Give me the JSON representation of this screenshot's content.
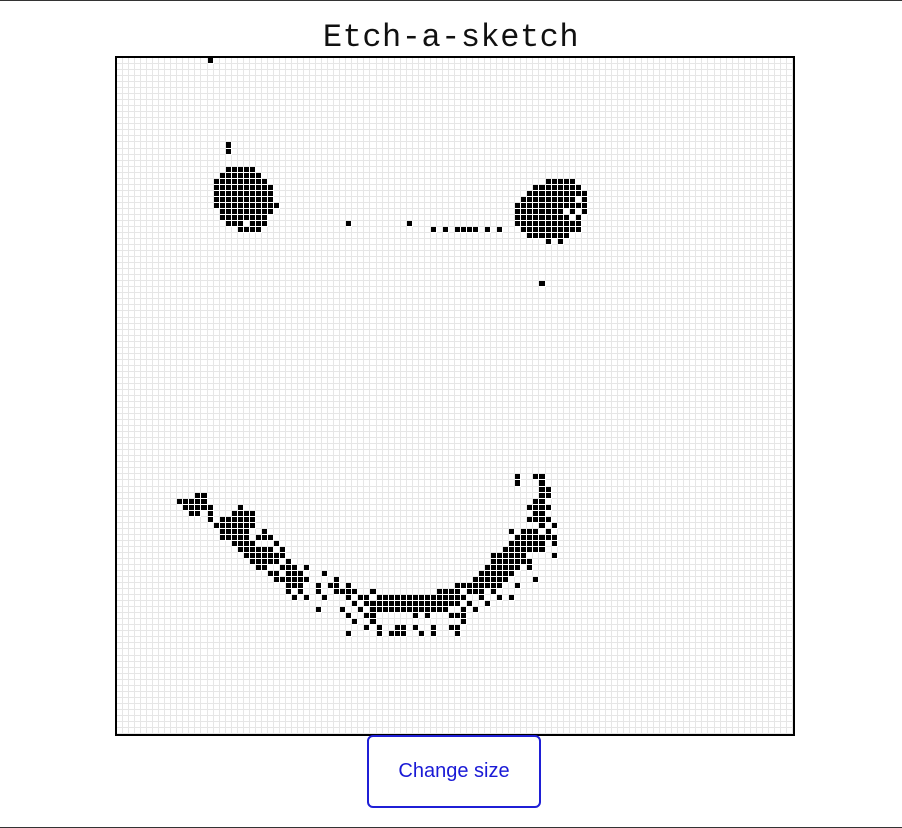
{
  "header": {
    "title": "Etch-a-sketch"
  },
  "board": {
    "cells_per_side": 112,
    "ink_color": "#000000",
    "grid_line_color": "#e6e6e6",
    "painted_cells": [
      [
        15,
        0
      ],
      [
        18,
        14
      ],
      [
        18,
        15
      ],
      [
        18,
        18
      ],
      [
        19,
        18
      ],
      [
        20,
        18
      ],
      [
        21,
        18
      ],
      [
        22,
        18
      ],
      [
        17,
        19
      ],
      [
        18,
        19
      ],
      [
        19,
        19
      ],
      [
        20,
        19
      ],
      [
        21,
        19
      ],
      [
        22,
        19
      ],
      [
        23,
        19
      ],
      [
        16,
        20
      ],
      [
        17,
        20
      ],
      [
        18,
        20
      ],
      [
        19,
        20
      ],
      [
        20,
        20
      ],
      [
        21,
        20
      ],
      [
        22,
        20
      ],
      [
        23,
        20
      ],
      [
        24,
        20
      ],
      [
        16,
        21
      ],
      [
        17,
        21
      ],
      [
        18,
        21
      ],
      [
        19,
        21
      ],
      [
        20,
        21
      ],
      [
        21,
        21
      ],
      [
        22,
        21
      ],
      [
        23,
        21
      ],
      [
        24,
        21
      ],
      [
        25,
        21
      ],
      [
        16,
        22
      ],
      [
        17,
        22
      ],
      [
        18,
        22
      ],
      [
        19,
        22
      ],
      [
        20,
        22
      ],
      [
        21,
        22
      ],
      [
        22,
        22
      ],
      [
        23,
        22
      ],
      [
        24,
        22
      ],
      [
        25,
        22
      ],
      [
        16,
        23
      ],
      [
        17,
        23
      ],
      [
        18,
        23
      ],
      [
        19,
        23
      ],
      [
        20,
        23
      ],
      [
        21,
        23
      ],
      [
        22,
        23
      ],
      [
        23,
        23
      ],
      [
        24,
        23
      ],
      [
        25,
        23
      ],
      [
        16,
        24
      ],
      [
        17,
        24
      ],
      [
        18,
        24
      ],
      [
        19,
        24
      ],
      [
        20,
        24
      ],
      [
        21,
        24
      ],
      [
        22,
        24
      ],
      [
        23,
        24
      ],
      [
        24,
        24
      ],
      [
        25,
        24
      ],
      [
        26,
        24
      ],
      [
        17,
        25
      ],
      [
        18,
        25
      ],
      [
        19,
        25
      ],
      [
        20,
        25
      ],
      [
        21,
        25
      ],
      [
        22,
        25
      ],
      [
        23,
        25
      ],
      [
        24,
        25
      ],
      [
        25,
        25
      ],
      [
        17,
        26
      ],
      [
        18,
        26
      ],
      [
        19,
        26
      ],
      [
        20,
        26
      ],
      [
        21,
        26
      ],
      [
        22,
        26
      ],
      [
        23,
        26
      ],
      [
        24,
        26
      ],
      [
        18,
        27
      ],
      [
        19,
        27
      ],
      [
        20,
        27
      ],
      [
        22,
        27
      ],
      [
        23,
        27
      ],
      [
        24,
        27
      ],
      [
        20,
        28
      ],
      [
        21,
        28
      ],
      [
        22,
        28
      ],
      [
        23,
        28
      ],
      [
        38,
        27
      ],
      [
        48,
        27
      ],
      [
        52,
        28
      ],
      [
        54,
        28
      ],
      [
        56,
        28
      ],
      [
        57,
        28
      ],
      [
        58,
        28
      ],
      [
        59,
        28
      ],
      [
        61,
        28
      ],
      [
        63,
        28
      ],
      [
        71,
        20
      ],
      [
        72,
        20
      ],
      [
        73,
        20
      ],
      [
        74,
        20
      ],
      [
        75,
        20
      ],
      [
        69,
        21
      ],
      [
        70,
        21
      ],
      [
        71,
        21
      ],
      [
        72,
        21
      ],
      [
        73,
        21
      ],
      [
        74,
        21
      ],
      [
        75,
        21
      ],
      [
        76,
        21
      ],
      [
        68,
        22
      ],
      [
        69,
        22
      ],
      [
        70,
        22
      ],
      [
        71,
        22
      ],
      [
        72,
        22
      ],
      [
        73,
        22
      ],
      [
        74,
        22
      ],
      [
        75,
        22
      ],
      [
        76,
        22
      ],
      [
        77,
        22
      ],
      [
        67,
        23
      ],
      [
        68,
        23
      ],
      [
        69,
        23
      ],
      [
        70,
        23
      ],
      [
        71,
        23
      ],
      [
        72,
        23
      ],
      [
        73,
        23
      ],
      [
        74,
        23
      ],
      [
        75,
        23
      ],
      [
        77,
        23
      ],
      [
        66,
        24
      ],
      [
        67,
        24
      ],
      [
        68,
        24
      ],
      [
        69,
        24
      ],
      [
        70,
        24
      ],
      [
        71,
        24
      ],
      [
        72,
        24
      ],
      [
        73,
        24
      ],
      [
        74,
        24
      ],
      [
        75,
        24
      ],
      [
        76,
        24
      ],
      [
        77,
        24
      ],
      [
        66,
        25
      ],
      [
        67,
        25
      ],
      [
        68,
        25
      ],
      [
        69,
        25
      ],
      [
        70,
        25
      ],
      [
        71,
        25
      ],
      [
        72,
        25
      ],
      [
        73,
        25
      ],
      [
        75,
        25
      ],
      [
        77,
        25
      ],
      [
        66,
        26
      ],
      [
        67,
        26
      ],
      [
        68,
        26
      ],
      [
        69,
        26
      ],
      [
        70,
        26
      ],
      [
        71,
        26
      ],
      [
        72,
        26
      ],
      [
        73,
        26
      ],
      [
        74,
        26
      ],
      [
        76,
        26
      ],
      [
        66,
        27
      ],
      [
        67,
        27
      ],
      [
        68,
        27
      ],
      [
        69,
        27
      ],
      [
        70,
        27
      ],
      [
        71,
        27
      ],
      [
        72,
        27
      ],
      [
        73,
        27
      ],
      [
        74,
        27
      ],
      [
        75,
        27
      ],
      [
        76,
        27
      ],
      [
        67,
        28
      ],
      [
        68,
        28
      ],
      [
        69,
        28
      ],
      [
        70,
        28
      ],
      [
        71,
        28
      ],
      [
        72,
        28
      ],
      [
        73,
        28
      ],
      [
        74,
        28
      ],
      [
        75,
        28
      ],
      [
        76,
        28
      ],
      [
        68,
        29
      ],
      [
        69,
        29
      ],
      [
        70,
        29
      ],
      [
        71,
        29
      ],
      [
        72,
        29
      ],
      [
        73,
        29
      ],
      [
        74,
        29
      ],
      [
        71,
        30
      ],
      [
        73,
        30
      ],
      [
        70,
        37
      ],
      [
        66,
        69
      ],
      [
        69,
        69
      ],
      [
        70,
        69
      ],
      [
        66,
        70
      ],
      [
        70,
        70
      ],
      [
        70,
        71
      ],
      [
        71,
        71
      ],
      [
        13,
        72
      ],
      [
        14,
        72
      ],
      [
        70,
        72
      ],
      [
        71,
        72
      ],
      [
        10,
        73
      ],
      [
        11,
        73
      ],
      [
        12,
        73
      ],
      [
        13,
        73
      ],
      [
        14,
        73
      ],
      [
        69,
        73
      ],
      [
        70,
        73
      ],
      [
        11,
        74
      ],
      [
        12,
        74
      ],
      [
        13,
        74
      ],
      [
        14,
        74
      ],
      [
        15,
        74
      ],
      [
        20,
        74
      ],
      [
        68,
        74
      ],
      [
        69,
        74
      ],
      [
        70,
        74
      ],
      [
        71,
        74
      ],
      [
        12,
        75
      ],
      [
        13,
        75
      ],
      [
        15,
        75
      ],
      [
        19,
        75
      ],
      [
        20,
        75
      ],
      [
        21,
        75
      ],
      [
        22,
        75
      ],
      [
        69,
        75
      ],
      [
        70,
        75
      ],
      [
        15,
        76
      ],
      [
        17,
        76
      ],
      [
        18,
        76
      ],
      [
        19,
        76
      ],
      [
        20,
        76
      ],
      [
        21,
        76
      ],
      [
        22,
        76
      ],
      [
        68,
        76
      ],
      [
        69,
        76
      ],
      [
        70,
        76
      ],
      [
        71,
        76
      ],
      [
        16,
        77
      ],
      [
        17,
        77
      ],
      [
        18,
        77
      ],
      [
        19,
        77
      ],
      [
        20,
        77
      ],
      [
        21,
        77
      ],
      [
        22,
        77
      ],
      [
        70,
        77
      ],
      [
        72,
        77
      ],
      [
        17,
        78
      ],
      [
        18,
        78
      ],
      [
        19,
        78
      ],
      [
        20,
        78
      ],
      [
        21,
        78
      ],
      [
        24,
        78
      ],
      [
        65,
        78
      ],
      [
        67,
        78
      ],
      [
        68,
        78
      ],
      [
        69,
        78
      ],
      [
        71,
        78
      ],
      [
        17,
        79
      ],
      [
        18,
        79
      ],
      [
        19,
        79
      ],
      [
        20,
        79
      ],
      [
        21,
        79
      ],
      [
        23,
        79
      ],
      [
        24,
        79
      ],
      [
        25,
        79
      ],
      [
        66,
        79
      ],
      [
        67,
        79
      ],
      [
        68,
        79
      ],
      [
        69,
        79
      ],
      [
        70,
        79
      ],
      [
        71,
        79
      ],
      [
        72,
        79
      ],
      [
        19,
        80
      ],
      [
        20,
        80
      ],
      [
        21,
        80
      ],
      [
        22,
        80
      ],
      [
        26,
        80
      ],
      [
        65,
        80
      ],
      [
        66,
        80
      ],
      [
        67,
        80
      ],
      [
        68,
        80
      ],
      [
        69,
        80
      ],
      [
        70,
        80
      ],
      [
        72,
        80
      ],
      [
        20,
        81
      ],
      [
        21,
        81
      ],
      [
        22,
        81
      ],
      [
        23,
        81
      ],
      [
        24,
        81
      ],
      [
        25,
        81
      ],
      [
        27,
        81
      ],
      [
        64,
        81
      ],
      [
        65,
        81
      ],
      [
        66,
        81
      ],
      [
        67,
        81
      ],
      [
        68,
        81
      ],
      [
        69,
        81
      ],
      [
        70,
        81
      ],
      [
        21,
        82
      ],
      [
        22,
        82
      ],
      [
        23,
        82
      ],
      [
        24,
        82
      ],
      [
        25,
        82
      ],
      [
        26,
        82
      ],
      [
        27,
        82
      ],
      [
        62,
        82
      ],
      [
        63,
        82
      ],
      [
        64,
        82
      ],
      [
        65,
        82
      ],
      [
        66,
        82
      ],
      [
        67,
        82
      ],
      [
        72,
        82
      ],
      [
        22,
        83
      ],
      [
        23,
        83
      ],
      [
        24,
        83
      ],
      [
        25,
        83
      ],
      [
        26,
        83
      ],
      [
        28,
        83
      ],
      [
        62,
        83
      ],
      [
        63,
        83
      ],
      [
        64,
        83
      ],
      [
        65,
        83
      ],
      [
        66,
        83
      ],
      [
        67,
        83
      ],
      [
        68,
        83
      ],
      [
        23,
        84
      ],
      [
        24,
        84
      ],
      [
        27,
        84
      ],
      [
        28,
        84
      ],
      [
        29,
        84
      ],
      [
        31,
        84
      ],
      [
        61,
        84
      ],
      [
        62,
        84
      ],
      [
        63,
        84
      ],
      [
        64,
        84
      ],
      [
        65,
        84
      ],
      [
        66,
        84
      ],
      [
        68,
        84
      ],
      [
        25,
        85
      ],
      [
        26,
        85
      ],
      [
        28,
        85
      ],
      [
        29,
        85
      ],
      [
        30,
        85
      ],
      [
        34,
        85
      ],
      [
        60,
        85
      ],
      [
        61,
        85
      ],
      [
        62,
        85
      ],
      [
        63,
        85
      ],
      [
        64,
        85
      ],
      [
        65,
        85
      ],
      [
        26,
        86
      ],
      [
        27,
        86
      ],
      [
        28,
        86
      ],
      [
        29,
        86
      ],
      [
        30,
        86
      ],
      [
        31,
        86
      ],
      [
        36,
        86
      ],
      [
        59,
        86
      ],
      [
        60,
        86
      ],
      [
        61,
        86
      ],
      [
        62,
        86
      ],
      [
        63,
        86
      ],
      [
        64,
        86
      ],
      [
        69,
        86
      ],
      [
        28,
        87
      ],
      [
        29,
        87
      ],
      [
        30,
        87
      ],
      [
        33,
        87
      ],
      [
        35,
        87
      ],
      [
        36,
        87
      ],
      [
        38,
        87
      ],
      [
        56,
        87
      ],
      [
        57,
        87
      ],
      [
        58,
        87
      ],
      [
        59,
        87
      ],
      [
        60,
        87
      ],
      [
        61,
        87
      ],
      [
        62,
        87
      ],
      [
        63,
        87
      ],
      [
        66,
        87
      ],
      [
        28,
        88
      ],
      [
        30,
        88
      ],
      [
        33,
        88
      ],
      [
        36,
        88
      ],
      [
        37,
        88
      ],
      [
        38,
        88
      ],
      [
        39,
        88
      ],
      [
        42,
        88
      ],
      [
        53,
        88
      ],
      [
        54,
        88
      ],
      [
        55,
        88
      ],
      [
        56,
        88
      ],
      [
        58,
        88
      ],
      [
        59,
        88
      ],
      [
        60,
        88
      ],
      [
        62,
        88
      ],
      [
        29,
        89
      ],
      [
        31,
        89
      ],
      [
        34,
        89
      ],
      [
        38,
        89
      ],
      [
        40,
        89
      ],
      [
        41,
        89
      ],
      [
        43,
        89
      ],
      [
        44,
        89
      ],
      [
        45,
        89
      ],
      [
        46,
        89
      ],
      [
        47,
        89
      ],
      [
        48,
        89
      ],
      [
        49,
        89
      ],
      [
        50,
        89
      ],
      [
        51,
        89
      ],
      [
        52,
        89
      ],
      [
        53,
        89
      ],
      [
        54,
        89
      ],
      [
        55,
        89
      ],
      [
        56,
        89
      ],
      [
        57,
        89
      ],
      [
        60,
        89
      ],
      [
        63,
        89
      ],
      [
        65,
        89
      ],
      [
        39,
        90
      ],
      [
        41,
        90
      ],
      [
        42,
        90
      ],
      [
        43,
        90
      ],
      [
        44,
        90
      ],
      [
        45,
        90
      ],
      [
        46,
        90
      ],
      [
        47,
        90
      ],
      [
        48,
        90
      ],
      [
        49,
        90
      ],
      [
        50,
        90
      ],
      [
        51,
        90
      ],
      [
        52,
        90
      ],
      [
        53,
        90
      ],
      [
        54,
        90
      ],
      [
        55,
        90
      ],
      [
        56,
        90
      ],
      [
        58,
        90
      ],
      [
        61,
        90
      ],
      [
        33,
        91
      ],
      [
        37,
        91
      ],
      [
        40,
        91
      ],
      [
        42,
        91
      ],
      [
        43,
        91
      ],
      [
        44,
        91
      ],
      [
        45,
        91
      ],
      [
        46,
        91
      ],
      [
        47,
        91
      ],
      [
        48,
        91
      ],
      [
        49,
        91
      ],
      [
        50,
        91
      ],
      [
        51,
        91
      ],
      [
        52,
        91
      ],
      [
        53,
        91
      ],
      [
        54,
        91
      ],
      [
        57,
        91
      ],
      [
        59,
        91
      ],
      [
        38,
        92
      ],
      [
        41,
        92
      ],
      [
        42,
        92
      ],
      [
        49,
        92
      ],
      [
        51,
        92
      ],
      [
        55,
        92
      ],
      [
        56,
        92
      ],
      [
        57,
        92
      ],
      [
        39,
        93
      ],
      [
        42,
        93
      ],
      [
        57,
        93
      ],
      [
        41,
        94
      ],
      [
        43,
        94
      ],
      [
        46,
        94
      ],
      [
        47,
        94
      ],
      [
        49,
        94
      ],
      [
        52,
        94
      ],
      [
        55,
        94
      ],
      [
        56,
        94
      ],
      [
        38,
        95
      ],
      [
        43,
        95
      ],
      [
        45,
        95
      ],
      [
        46,
        95
      ],
      [
        47,
        95
      ],
      [
        50,
        95
      ],
      [
        52,
        95
      ],
      [
        56,
        95
      ]
    ]
  },
  "controls": {
    "change_size_label": "Change size"
  }
}
